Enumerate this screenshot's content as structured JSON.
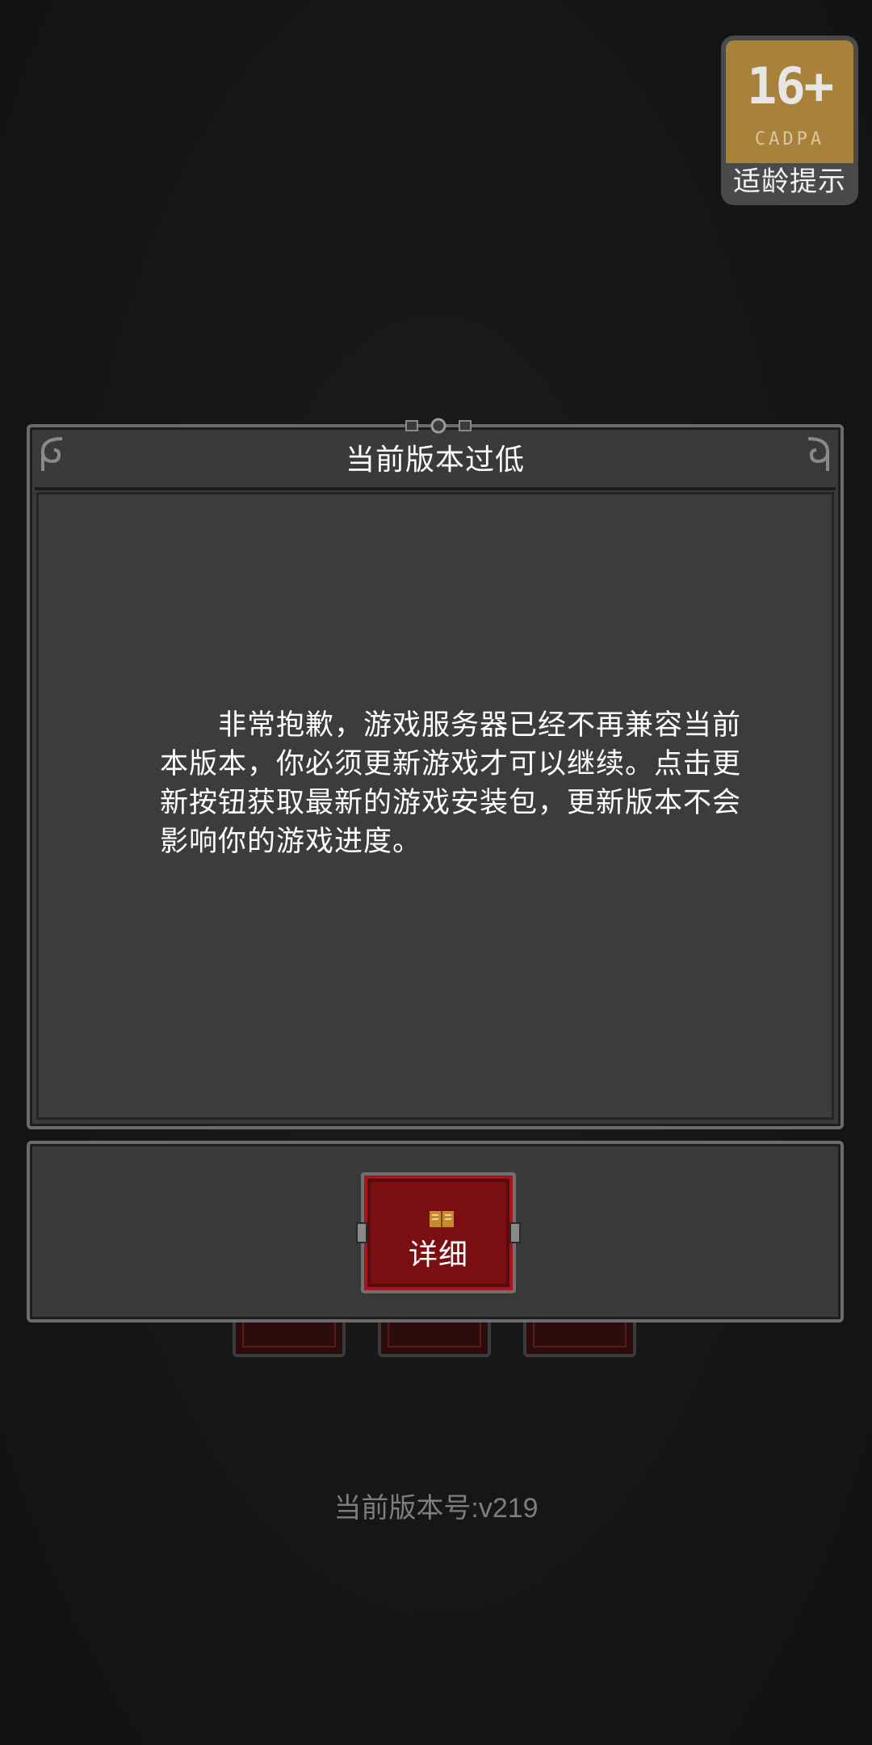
{
  "age_badge": {
    "rating": "16+",
    "org": "CADPA",
    "caption": "适龄提示"
  },
  "dialog": {
    "title": "当前版本过低",
    "message": "非常抱歉，游戏服务器已经不再兼容当前本版本，你必须更新游戏才可以继续。点击更新按钮获取最新的游戏安装包，更新版本不会影响你的游戏进度。"
  },
  "actions": {
    "detail_label": "详细",
    "detail_icon": "book-icon"
  },
  "footer": {
    "version": "当前版本号:v219"
  },
  "colors": {
    "background": "#151515",
    "panel": "#3a3a3a",
    "button_red": "#7a0f12",
    "badge_gold": "#a8813b"
  }
}
